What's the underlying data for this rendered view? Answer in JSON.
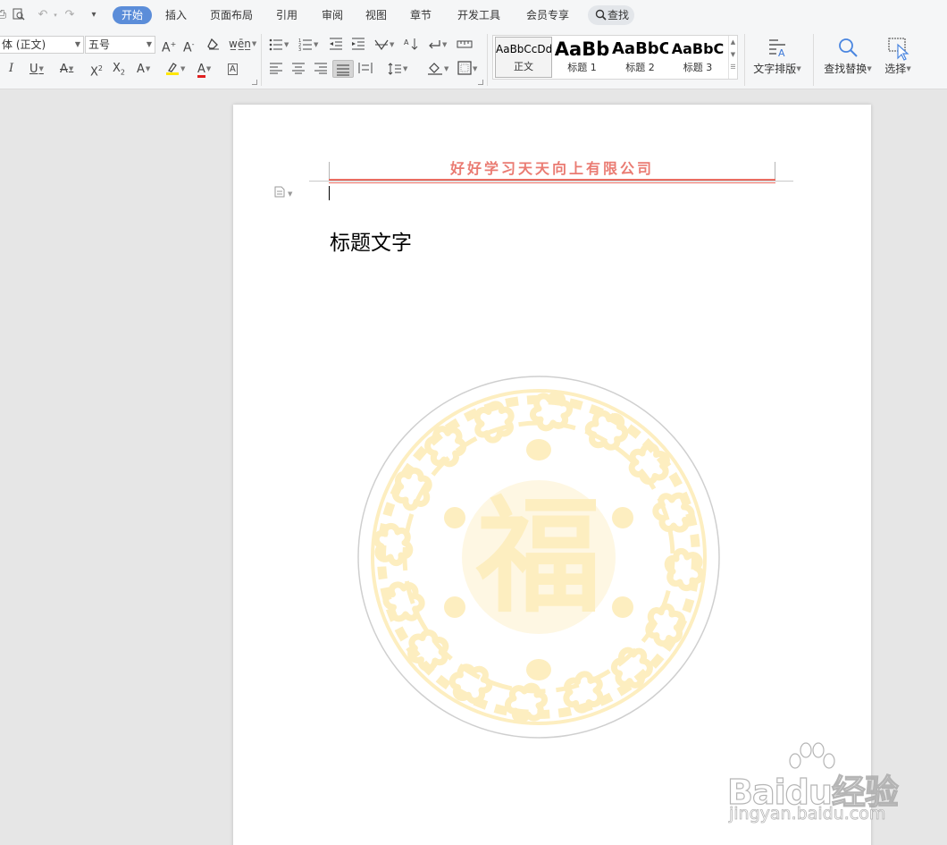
{
  "tabs": [
    {
      "label": "开始",
      "active": true
    },
    {
      "label": "插入"
    },
    {
      "label": "页面布局"
    },
    {
      "label": "引用"
    },
    {
      "label": "审阅"
    },
    {
      "label": "视图"
    },
    {
      "label": "章节"
    },
    {
      "label": "开发工具"
    },
    {
      "label": "会员专享"
    }
  ],
  "search": {
    "label": "查找"
  },
  "font": {
    "name": "体 (正文)",
    "size": "五号"
  },
  "styles": [
    {
      "sample": "AaBbCcDd",
      "label": "正文",
      "selected": true
    },
    {
      "sample": "AaBb",
      "label": "标题 1"
    },
    {
      "sample": "AaBbC",
      "label": "标题 2"
    },
    {
      "sample": "AaBbC",
      "label": "标题 3"
    }
  ],
  "ribbon_buttons": {
    "text_layout": "文字排版",
    "find_replace": "查找替换",
    "select": "选择"
  },
  "document": {
    "header_text": "好好学习天天向上有限公司",
    "title": "标题文字",
    "seal_character": "福"
  },
  "watermark": {
    "brand": "Baidu经验",
    "url": "jingyan.baidu.com"
  },
  "colors": {
    "accent": "#5b8dd9",
    "header_red": "#ea7b72",
    "seal_gold": "#fdeec0",
    "page_bg": "#e6e6e6"
  }
}
